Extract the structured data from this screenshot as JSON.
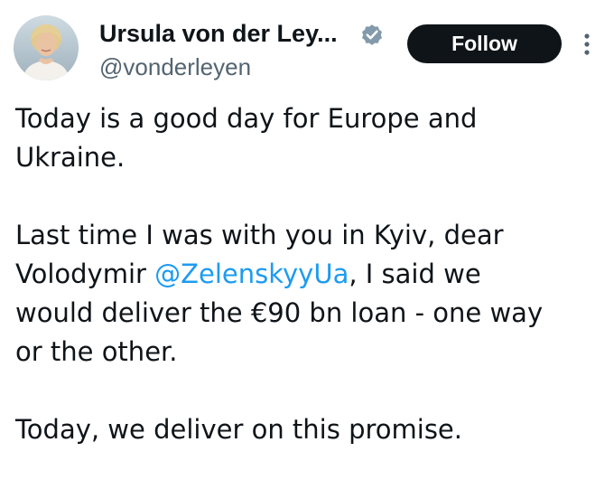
{
  "author": {
    "display_name": "Ursula von der Ley...",
    "handle": "@vonderleyen",
    "verified": true
  },
  "actions": {
    "follow_label": "Follow",
    "more_icon": "more-vertical-icon"
  },
  "tweet": {
    "line_1": "Today is a good day for Europe and",
    "line_2": "Ukraine.",
    "line_3": "Last time I was with you in Kyiv, dear",
    "line_4_pre": "Volodymir ",
    "mention": "@ZelenskyyUa",
    "line_4_post": ", I said we",
    "line_5": "would deliver the €90 bn loan - one way",
    "line_6": "or the other.",
    "line_7": "Today, we deliver on this promise."
  },
  "colors": {
    "text": "#0f1419",
    "secondary": "#536471",
    "link": "#1d9bf0",
    "button_bg": "#0f1419",
    "verified": "#829aab"
  }
}
